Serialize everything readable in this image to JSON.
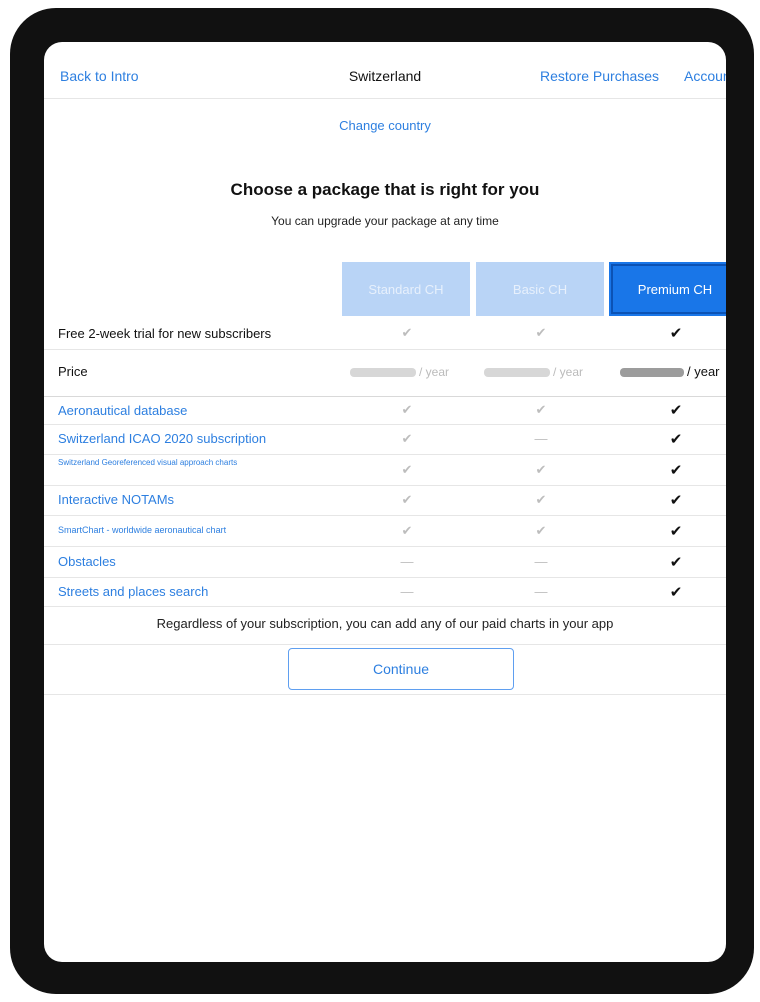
{
  "header": {
    "back_label": "Back to Intro",
    "title": "Switzerland",
    "restore_label": "Restore Purchases",
    "account_label": "Account"
  },
  "change_country": "Change country",
  "headline": "Choose a package that is right for you",
  "subheadline": "You can upgrade your package at any time",
  "packages": [
    {
      "label": "Standard CH",
      "selected": false
    },
    {
      "label": "Basic CH",
      "selected": false
    },
    {
      "label": "Premium CH",
      "selected": true
    }
  ],
  "trial_label": "Free 2-week trial for new subscribers",
  "price_label": "Price",
  "price_period": "/ year",
  "features": [
    {
      "label": "Aeronautical database",
      "values": [
        "✔",
        "✔",
        "✔"
      ]
    },
    {
      "label": "Switzerland ICAO 2020 subscription",
      "values": [
        "✔",
        "—",
        "✔"
      ]
    },
    {
      "label": "Switzerland Georeferenced visual approach charts",
      "values": [
        "✔",
        "✔",
        "✔"
      ]
    },
    {
      "label": "Interactive NOTAMs",
      "values": [
        "✔",
        "✔",
        "✔"
      ]
    },
    {
      "label": "SmartChart - worldwide aeronautical chart",
      "values": [
        "✔",
        "✔",
        "✔"
      ]
    },
    {
      "label": "Obstacles",
      "values": [
        "—",
        "—",
        "✔"
      ]
    },
    {
      "label": "Streets and places search",
      "values": [
        "—",
        "—",
        "✔"
      ]
    }
  ],
  "trial_values": [
    "✔",
    "✔",
    "✔"
  ],
  "footer_note": "Regardless of your subscription, you can add any of our paid charts in your app",
  "continue_label": "Continue",
  "colors": {
    "accent": "#2d7fe0",
    "selected": "#1976e8",
    "dimmed": "#b9d4f6"
  }
}
